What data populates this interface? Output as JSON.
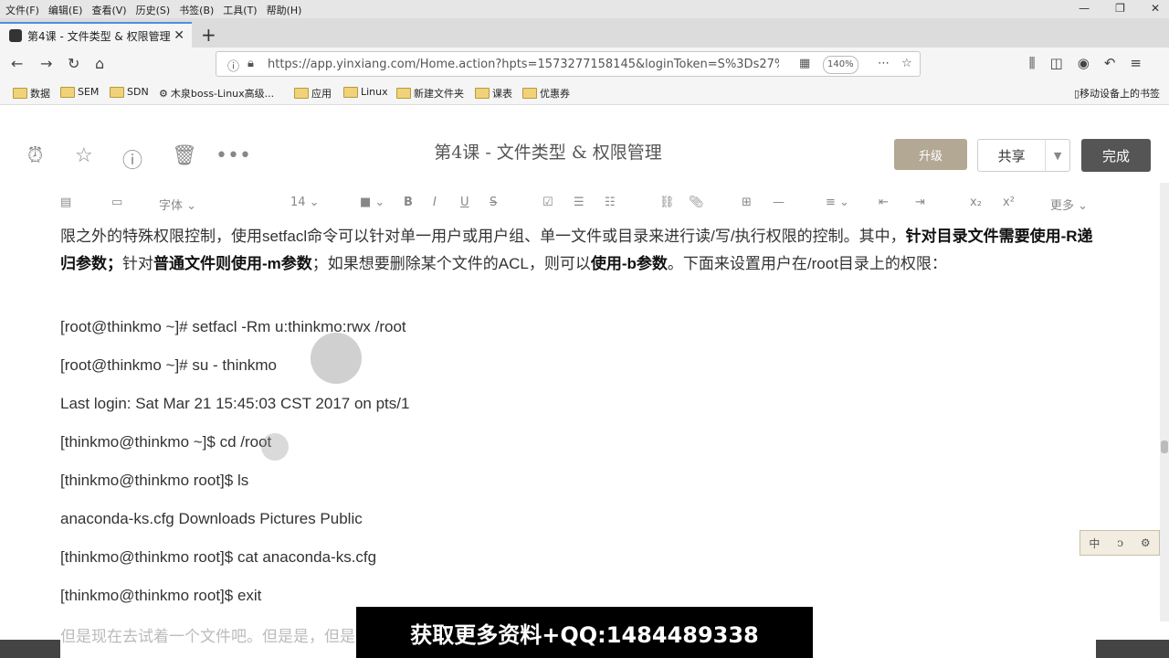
{
  "menu": [
    "文件(F)",
    "编辑(E)",
    "查看(V)",
    "历史(S)",
    "书签(B)",
    "工具(T)",
    "帮助(H)"
  ],
  "window_controls": [
    "—",
    "❐",
    "✕"
  ],
  "tab": {
    "title": "第4课 - 文件类型 & 权限管理",
    "close": "✕"
  },
  "new_tab": "+",
  "url": "https://app.yinxiang.com/Home.action?hpts=1573277158145&loginToken=S%3Ds27%",
  "zoom": "140%",
  "bookmarks": [
    "数据",
    "SEM",
    "SDN",
    "木泉boss-Linux高级...",
    "应用",
    "Linux",
    "新建文件夹",
    "课表",
    "优惠券"
  ],
  "mobile_bookmarks": "移动设备上的书签",
  "note": {
    "title": "第4课 - 文件类型 & 权限管理",
    "upgrade": "升级",
    "share": "共享",
    "done": "完成"
  },
  "toolbar": {
    "font": "字体",
    "size": "14",
    "more": "更多"
  },
  "content": {
    "p1_a": "限之外的特殊权限控制，使用setfacl命令可以针对单一用户或用户组、单一文件或目录来进行读/写/执行权限的控制。其中，",
    "p1_b": "针对目录文件需要使用-R递归参数；",
    "p1_c": "针对",
    "p1_d": "普通文件则使用-m参数",
    "p1_e": "；如果想要删除某个文件的ACL，则可以",
    "p1_f": "使用-b参数",
    "p1_g": "。下面来设置用户在/root目录上的权限：",
    "lines": [
      "[root@thinkmo ~]# setfacl -Rm u:thinkmo:rwx /root",
      "[root@thinkmo ~]# su - thinkmo",
      "Last login: Sat Mar 21 15:45:03 CST 2017 on pts/1",
      "[thinkmo@thinkmo ~]$ cd /root",
      "[thinkmo@thinkmo root]$ ls",
      "anaconda-ks.cfg Downloads Pictures Public",
      "[thinkmo@thinkmo root]$ cat anaconda-ks.cfg",
      "[thinkmo@thinkmo root]$ exit"
    ],
    "bottom_partial": "但是现在去试着一个文件吧。但是是，但是却可以看到文件的权限最后一个"
  },
  "ime": [
    "中",
    "ↄ",
    "⚙"
  ],
  "banner": "获取更多资料+QQ:1484489338"
}
